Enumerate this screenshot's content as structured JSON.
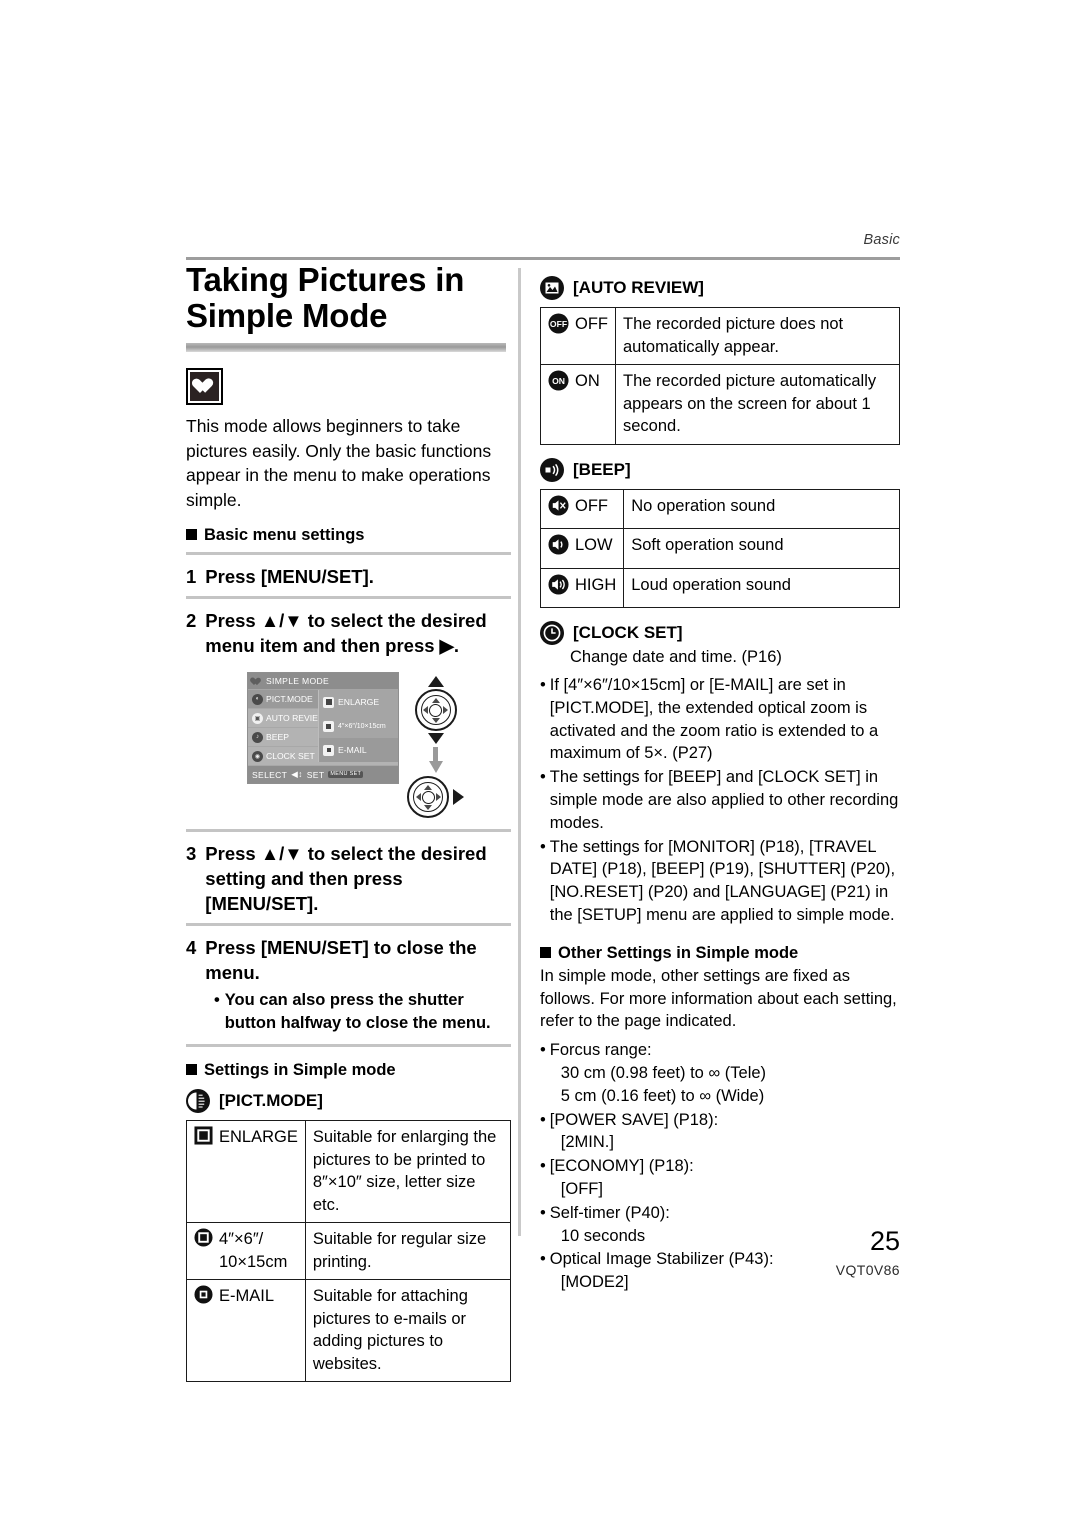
{
  "header": {
    "running_head": "Basic"
  },
  "footer": {
    "page_number": "25",
    "doc_id": "VQT0V86"
  },
  "left": {
    "title": "Taking Pictures in Simple Mode",
    "mode_icon": "simple-mode-heart-icon",
    "intro": "This mode allows beginners to take pictures easily. Only the basic functions appear in the menu to make operations simple.",
    "basic_menu_heading": "Basic menu settings",
    "steps": [
      {
        "num": "1",
        "text": "Press [MENU/SET]."
      },
      {
        "num": "2",
        "text": "Press ▲/▼ to select the desired menu item and then press ▶."
      },
      {
        "num": "3",
        "text": "Press ▲/▼ to select the desired setting and then press [MENU/SET]."
      },
      {
        "num": "4",
        "text": "Press [MENU/SET] to close the menu."
      }
    ],
    "step4_note": "You can also press the shutter button halfway to close the menu.",
    "lcd": {
      "title": "SIMPLE MODE",
      "menu_items": [
        "PICT.MODE",
        "AUTO REVIEW",
        "BEEP",
        "CLOCK SET"
      ],
      "submenu_items": [
        "ENLARGE",
        "4″×6″/10×15cm",
        "E-MAIL"
      ],
      "footer_select": "SELECT",
      "footer_set": "SET",
      "footer_chip": "MENU SET"
    },
    "settings_heading": "Settings in Simple mode",
    "pictmode_title": "[PICT.MODE]",
    "pictmode_rows": [
      {
        "key": "ENLARGE",
        "key2": "",
        "desc": "Suitable for enlarging the pictures to be printed to 8″×10″ size, letter size etc."
      },
      {
        "key": "4″×6″/",
        "key2": "10×15cm",
        "desc": "Suitable for regular size printing."
      },
      {
        "key": "E-MAIL",
        "key2": "",
        "desc": "Suitable for attaching pictures to e-mails or adding pictures to websites."
      }
    ]
  },
  "right": {
    "autoreview_title": "[AUTO REVIEW]",
    "autoreview_rows": [
      {
        "key": "OFF",
        "desc": "The recorded picture does not automatically appear."
      },
      {
        "key": "ON",
        "desc": "The recorded picture automatically appears on the screen for about 1 second."
      }
    ],
    "beep_title": "[BEEP]",
    "beep_rows": [
      {
        "key": "OFF",
        "desc": "No operation sound"
      },
      {
        "key": "LOW",
        "desc": "Soft operation sound"
      },
      {
        "key": "HIGH",
        "desc": "Loud operation sound"
      }
    ],
    "clockset_title": "[CLOCK SET]",
    "clockset_desc": "Change date and time. (P16)",
    "notes": [
      "If [4″×6″/10×15cm] or [E-MAIL] are set in [PICT.MODE], the extended optical zoom is activated and the zoom ratio is extended to a maximum of 5×. (P27)",
      "The settings for [BEEP] and [CLOCK SET] in simple mode are also applied to other recording modes.",
      "The settings for [MONITOR] (P18), [TRAVEL DATE] (P18), [BEEP] (P19), [SHUTTER] (P20),  [NO.RESET] (P20) and [LANGUAGE] (P21) in the [SETUP] menu are applied to simple mode."
    ],
    "other_heading": "Other Settings in Simple mode",
    "other_intro": "In simple mode, other settings are fixed as follows. For more information about each setting, refer to the page indicated.",
    "other_items": [
      {
        "label": "Forcus range:",
        "values": [
          "30 cm (0.98 feet) to ∞ (Tele)",
          "5 cm (0.16 feet) to ∞ (Wide)"
        ]
      },
      {
        "label": "[POWER SAVE] (P18):",
        "values": [
          "[2MIN.]"
        ]
      },
      {
        "label": "[ECONOMY] (P18):",
        "values": [
          "[OFF]"
        ]
      },
      {
        "label": "Self-timer (P40):",
        "values": [
          "10 seconds"
        ]
      },
      {
        "label": "Optical Image Stabilizer (P43):",
        "values": [
          "[MODE2]"
        ]
      }
    ]
  }
}
